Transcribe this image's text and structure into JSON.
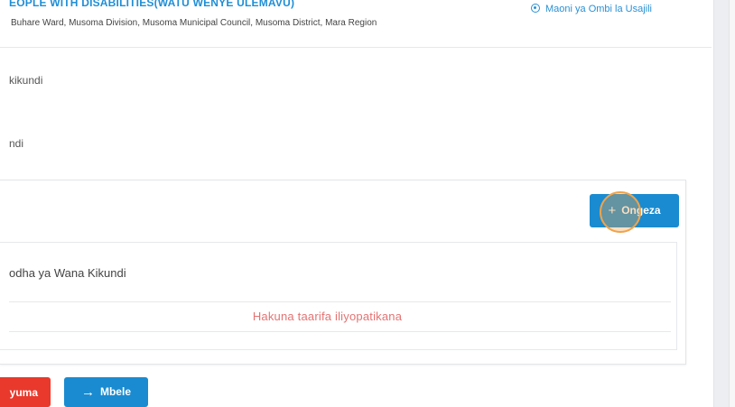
{
  "header": {
    "group_name": "EOPLE WITH DISABILITIES(WATU WENYE ULEMAVU)",
    "location": "Buhare Ward, Musoma Division, Musoma Municipal Council, Musoma District, Mara Region",
    "review_link": "Maoni ya Ombi la Usajili",
    "review_icon": "eye-icon"
  },
  "fields": {
    "label_1": "kikundi",
    "label_2": "ndi"
  },
  "members": {
    "add_label": "Ongeza",
    "add_icon": "plus-icon",
    "table_title": "odha ya Wana Kikundi",
    "empty_message": "Hakuna taarifa iliyopatikana"
  },
  "footer": {
    "back_label": "yuma",
    "next_label": "Mbele",
    "next_icon": "arrow-right-icon"
  },
  "colors": {
    "primary": "#1a8bd0",
    "danger": "#e8392c",
    "empty_text": "#e57373",
    "click_indicator": "#f0a34a"
  }
}
